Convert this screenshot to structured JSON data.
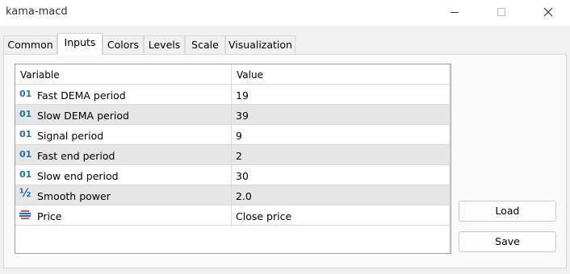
{
  "window": {
    "title": "kama-macd"
  },
  "tabs": [
    {
      "label": "Common"
    },
    {
      "label": "Inputs"
    },
    {
      "label": "Colors"
    },
    {
      "label": "Levels"
    },
    {
      "label": "Scale"
    },
    {
      "label": "Visualization"
    }
  ],
  "active_tab": "Inputs",
  "grid": {
    "headers": {
      "variable": "Variable",
      "value": "Value"
    },
    "rows": [
      {
        "icon": "integer-icon",
        "icon_text": "01",
        "variable": "Fast DEMA period",
        "value": "19"
      },
      {
        "icon": "integer-icon",
        "icon_text": "01",
        "variable": "Slow DEMA period",
        "value": "39"
      },
      {
        "icon": "integer-icon",
        "icon_text": "01",
        "variable": "Signal period",
        "value": "9"
      },
      {
        "icon": "integer-icon",
        "icon_text": "01",
        "variable": "Fast end period",
        "value": "2"
      },
      {
        "icon": "integer-icon",
        "icon_text": "01",
        "variable": "Slow end period",
        "value": "30"
      },
      {
        "icon": "fraction-icon",
        "icon_text": "½",
        "variable": "Smooth power",
        "value": "2.0"
      },
      {
        "icon": "enum-icon",
        "icon_text": "",
        "variable": "Price",
        "value": "Close price"
      }
    ]
  },
  "buttons": {
    "load": "Load",
    "save": "Save"
  },
  "colors": {
    "icon_blue": "#1f6fb8",
    "icon_red": "#d9534f",
    "alt_row": "#e6e6e6"
  }
}
